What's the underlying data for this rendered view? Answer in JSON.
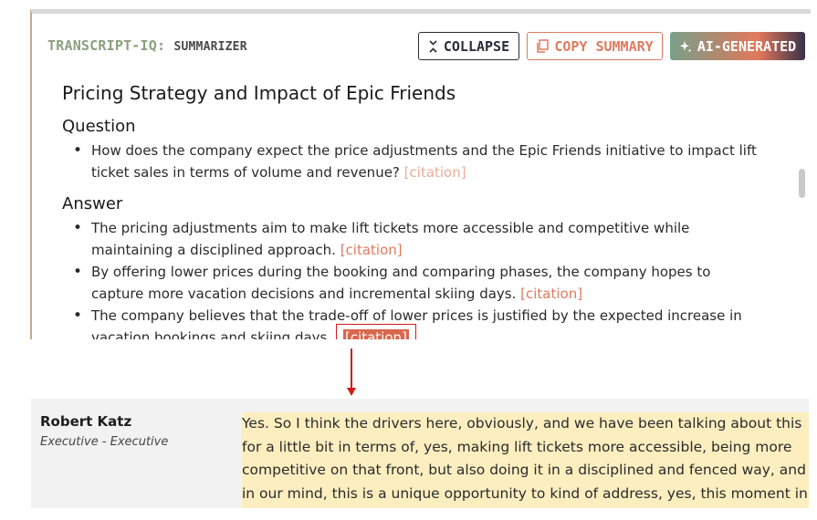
{
  "header": {
    "brand_main": "TRANSCRIPT-IQ:",
    "brand_sub": "SUMMARIZER",
    "collapse_label": "COLLAPSE",
    "copy_label": "COPY SUMMARY",
    "ai_label": "AI-GENERATED"
  },
  "summary": {
    "title": "Pricing Strategy and Impact of Epic Friends",
    "question_heading": "Question",
    "question_text": "How does the company expect the price adjustments and the Epic Friends initiative to impact lift ticket sales in terms of volume and revenue?",
    "answer_heading": "Answer",
    "answers": [
      "The pricing adjustments aim to make lift tickets more accessible and competitive while maintaining a disciplined approach.",
      "By offering lower prices during the booking and comparing phases, the company hopes to capture more vacation decisions and incremental skiing days.",
      "The company believes that the trade-off of lower prices is justified by the expected increase in vacation bookings and skiing days."
    ],
    "citation_label": "[citation]"
  },
  "excerpt": {
    "speaker": "Robert Katz",
    "role": "Executive - Executive",
    "text": "Yes. So I think the drivers here, obviously, and we have been talking about this for a little bit in terms of, yes, making lift tickets more accessible, being more competitive on that front, but also doing it in a disciplined and fenced way, and in our mind, this is a unique opportunity to kind of address, yes, this moment in"
  },
  "colors": {
    "accent": "#e07a5f",
    "highlight": "#fdeec0",
    "annotation": "#d21a1a"
  }
}
